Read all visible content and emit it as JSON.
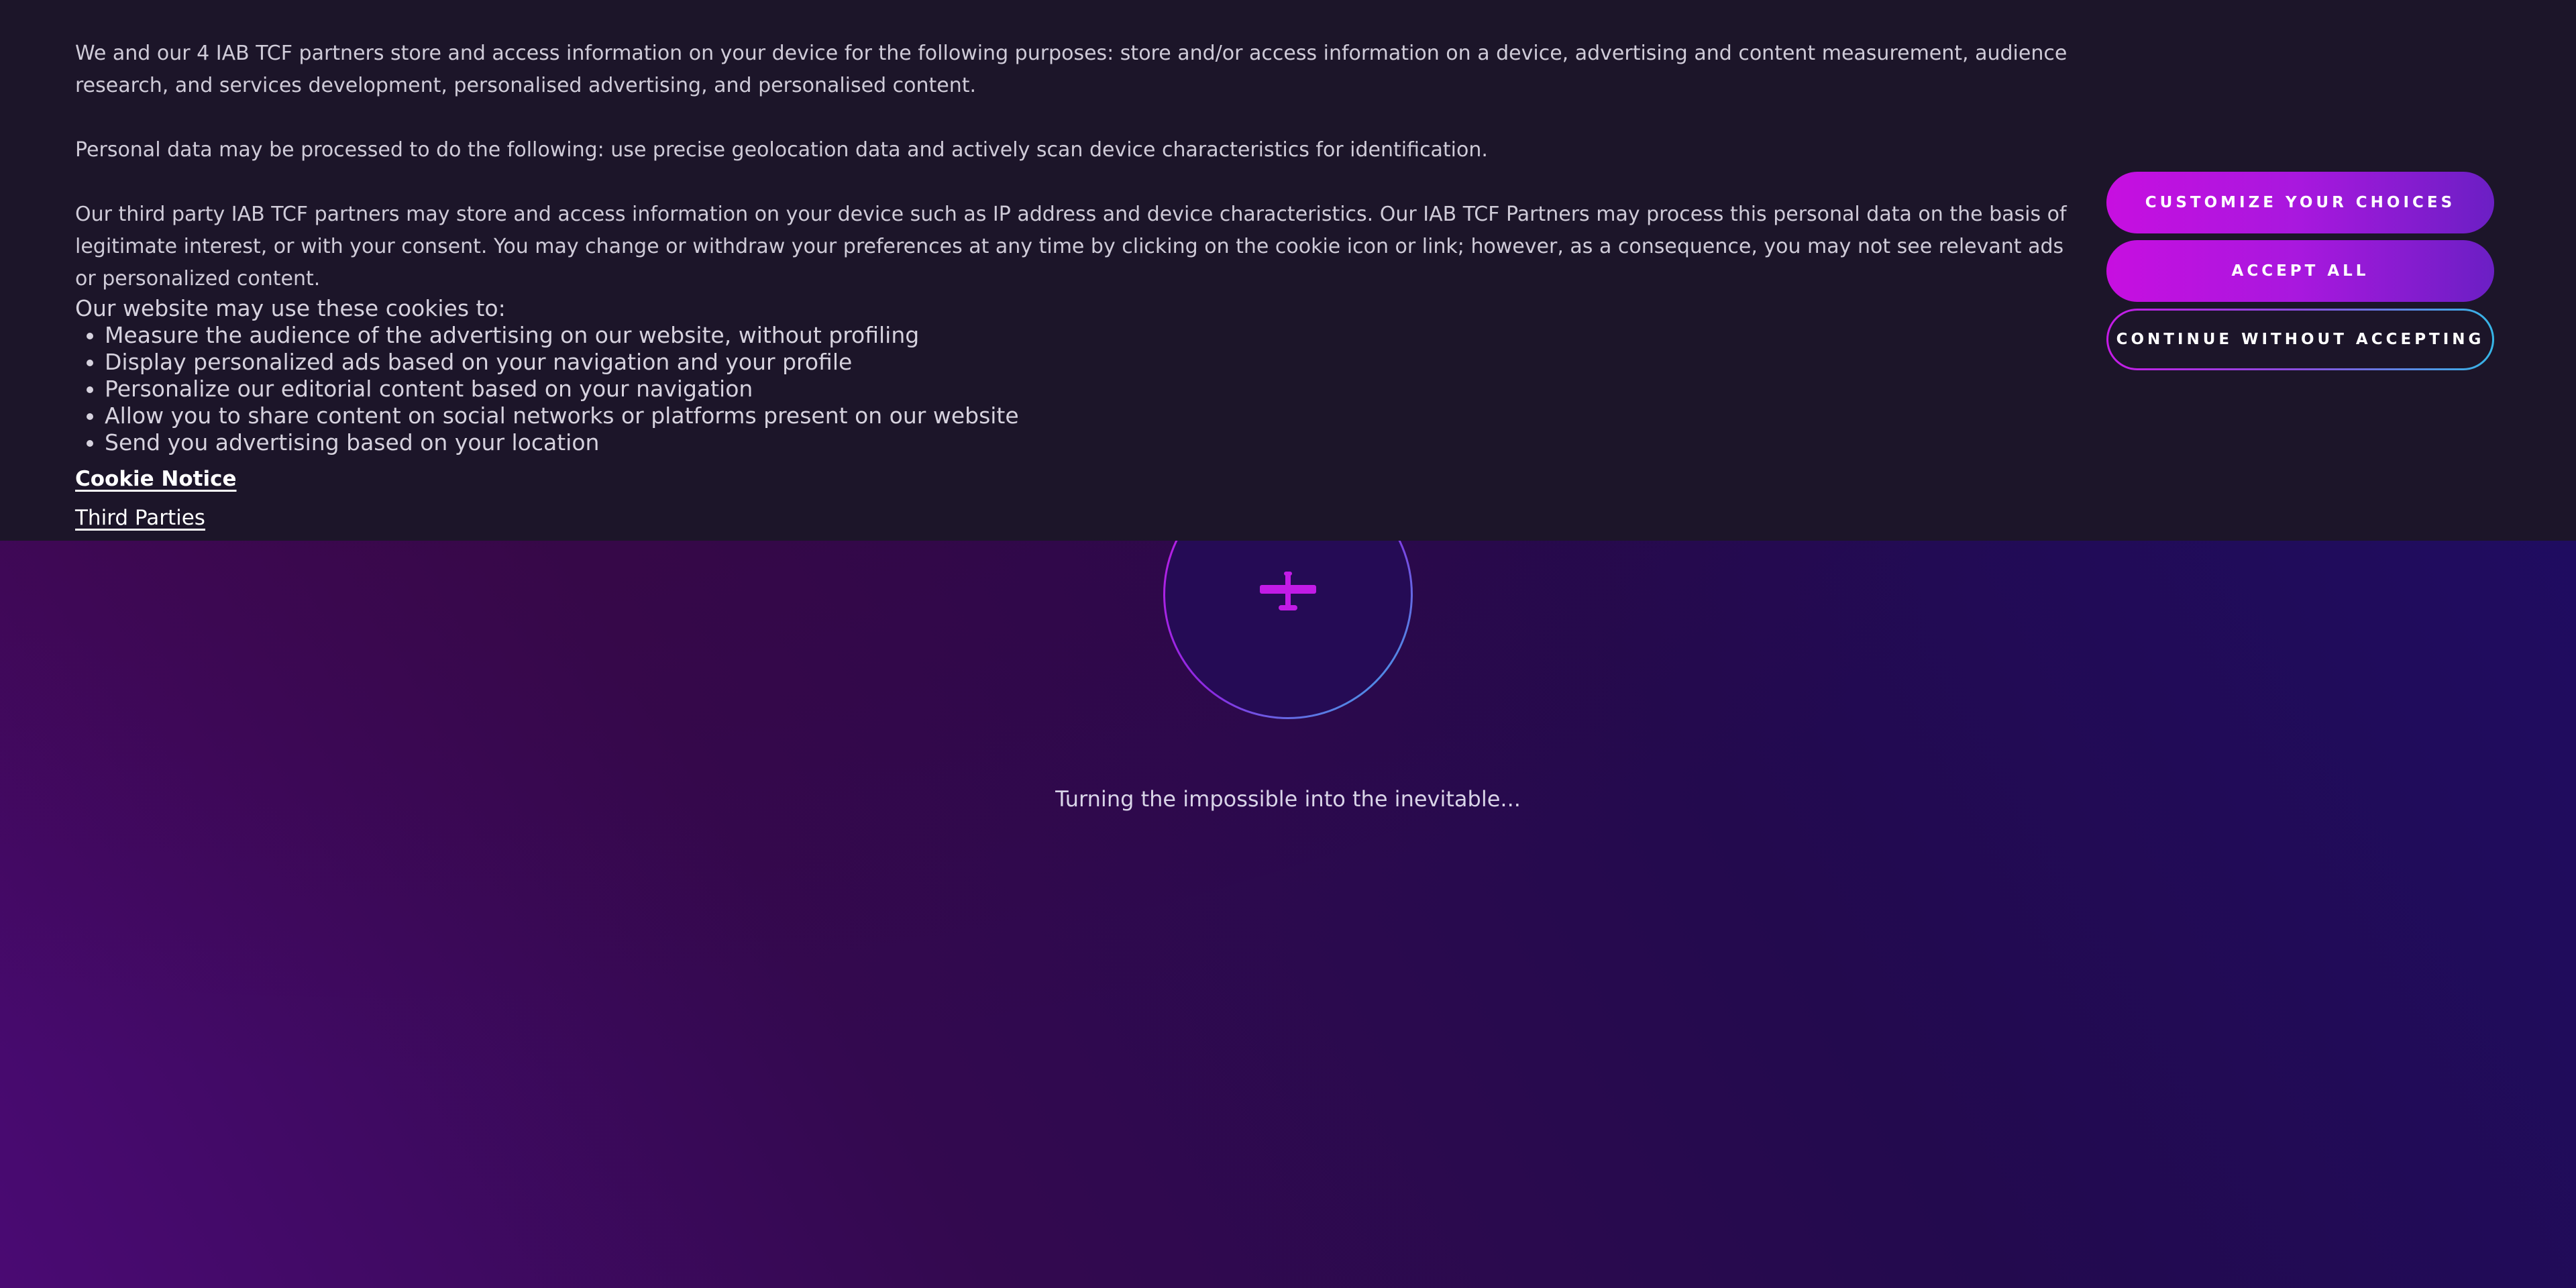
{
  "banner": {
    "paragraphs": [
      "We and our 4 IAB TCF partners store and access information on your device for the following purposes: store and/or access information on a device, advertising and content measurement, audience research, and services development, personalised advertising, and personalised content.",
      "Personal data may be processed to do the following: use precise geolocation data and actively scan device characteristics for identification.",
      "Our third party IAB TCF partners may store and access information on your device such as IP address and device characteristics. Our IAB TCF Partners may process this personal data on the basis of legitimate interest, or with your consent. You may change or withdraw your preferences at any time by clicking on the cookie icon or link; however, as a consequence, you may not see relevant ads or personalized content."
    ],
    "cookie_intro": "Our website may use these cookies to:",
    "cookie_uses": [
      "Measure the audience of the advertising on our website, without profiling",
      "Display personalized ads based on your navigation and your profile",
      "Personalize our editorial content based on your navigation",
      "Allow you to share content on social networks or platforms present on our website",
      "Send you advertising based on your location"
    ],
    "links": {
      "cookie_notice": "Cookie Notice",
      "third_parties": "Third Parties"
    },
    "buttons": {
      "customize": "CUSTOMIZE YOUR CHOICES",
      "accept_all": "ACCEPT ALL",
      "continue_without": "CONTINUE WITHOUT ACCEPTING"
    }
  },
  "loader": {
    "icon": "plane-icon",
    "tagline": "Turning the impossible into the inevitable..."
  },
  "colors": {
    "banner_background": "#1c1529",
    "accent_magenta": "#c51be6",
    "accent_blue": "#36b6e6",
    "page_gradient_start": "#4a0a73",
    "page_gradient_end": "#1e0d66"
  }
}
